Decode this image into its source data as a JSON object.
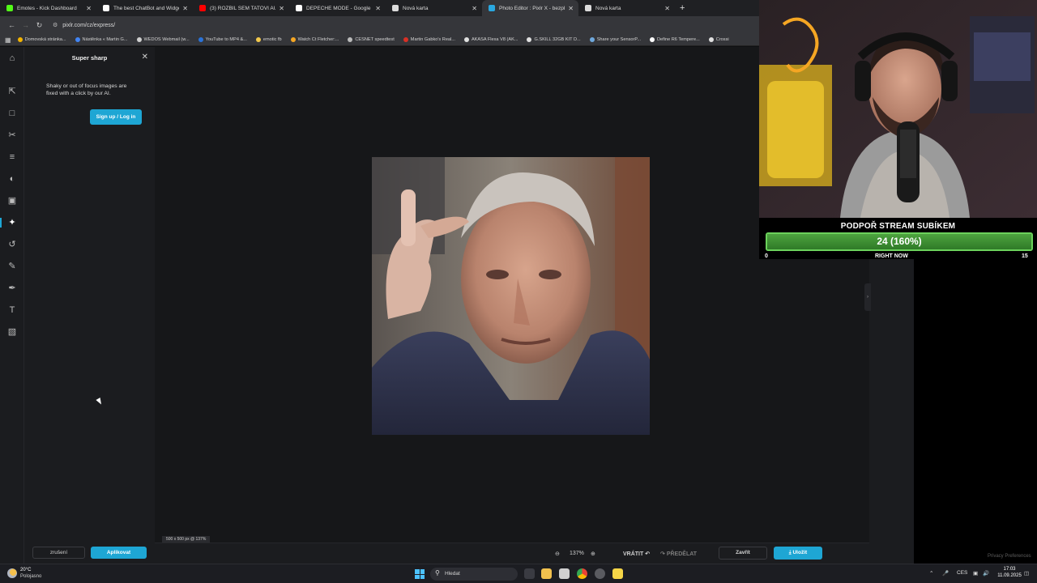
{
  "browser": {
    "tabs": [
      {
        "title": "Emotes - Kick Dashboard",
        "fav_color": "#53fc18",
        "active": false
      },
      {
        "title": "The best ChatBot and Widgets",
        "fav_color": "#ffffff",
        "active": false
      },
      {
        "title": "(3) ROZBIL SEM TATOVI AUTO",
        "fav_color": "#ff0000",
        "active": false
      },
      {
        "title": "DEPECHE MODE - Google Search",
        "fav_color": "#ffffff",
        "active": false
      },
      {
        "title": "Nová karta",
        "fav_color": "#dcdcdc",
        "active": false
      },
      {
        "title": "Photo Editor : Pixlr X - bezplatné",
        "fav_color": "#2aa8e0",
        "active": true
      },
      {
        "title": "Nová karta",
        "fav_color": "#dcdcdc",
        "active": false
      }
    ],
    "new_tab_label": "+",
    "url": "pixlr.com/cz/express/",
    "bookmarks": [
      {
        "label": "Domovská stránka...",
        "color": "#f4b400"
      },
      {
        "label": "Nástěnka « Martin G...",
        "color": "#4285f4"
      },
      {
        "label": "WEDOS Webmail (w...",
        "color": "#d0d0d0"
      },
      {
        "label": "YouTube to MP4 &...",
        "color": "#2a73d9"
      },
      {
        "label": "emotic fb",
        "color": "#f2c94c"
      },
      {
        "label": "Watch Ct Fletcher:...",
        "color": "#f5a623"
      },
      {
        "label": "CESNET speedtest",
        "color": "#bbbbbb"
      },
      {
        "label": "Martin Gabko's Real...",
        "color": "#d93025"
      },
      {
        "label": "AKASA Flexa V8 (AK...",
        "color": "#e0e0e0"
      },
      {
        "label": "G.SKILL 32GB KIT D...",
        "color": "#e0e0e0"
      },
      {
        "label": "Share your SensorP...",
        "color": "#6fa8dc"
      },
      {
        "label": "Define R6 Tempere...",
        "color": "#ffffff"
      },
      {
        "label": "Crossi",
        "color": "#e0e0e0"
      }
    ]
  },
  "editor": {
    "panel": {
      "title": "Super sharp",
      "description": "Shaky or out of focus images are fixed with a click by our AI.",
      "signup_label": "Sign up / Log in",
      "cancel_label": "zrušení",
      "apply_label": "Aplikovat"
    },
    "rail_icons": [
      "home-icon",
      "arrange-icon",
      "crop-icon",
      "cutout-icon",
      "adjust-icon",
      "filter-icon",
      "effect-icon",
      "ai-tools-icon",
      "liquify-icon",
      "retouch-icon",
      "draw-icon",
      "text-icon",
      "elements-icon"
    ],
    "size_label": "500 x 500 px @ 137%",
    "zoom_value": "137%",
    "undo_label": "VRÁTIT",
    "redo_label": "PŘEDĚLAT",
    "close_label": "Zavřít",
    "save_label": "Uložit",
    "privacy_label": "Privacy Preferences"
  },
  "stream_widget": {
    "title": "PODPOŘ STREAM SUBÍKEM",
    "bar_text": "24 (160%)",
    "progress_fraction": 1.0,
    "left_label": "0",
    "middle_label": "RIGHT NOW",
    "right_label": "15",
    "accent_color": "#6bd25b"
  },
  "taskbar": {
    "weather_temp": "20°C",
    "weather_desc": "Polojasno",
    "search_placeholder": "Hledat",
    "language": "CES",
    "time": "17:03",
    "date": "11.09.2025"
  }
}
